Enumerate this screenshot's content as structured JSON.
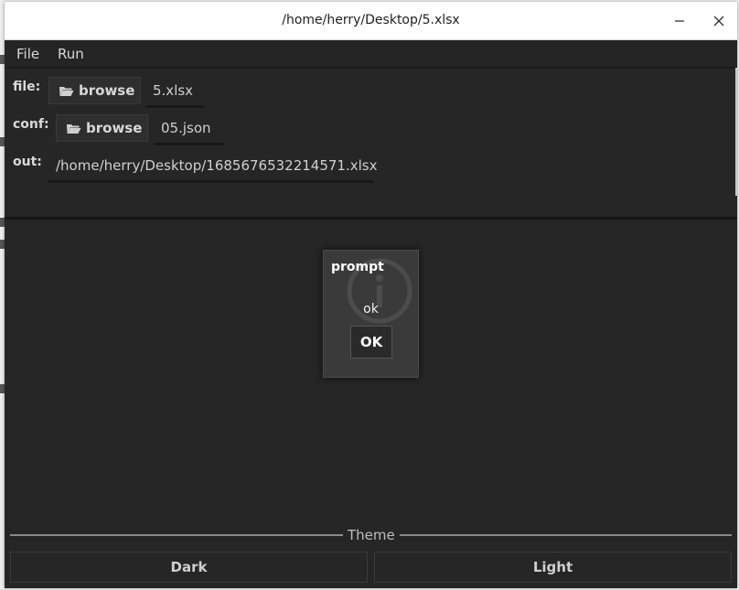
{
  "window": {
    "title": "/home/herry/Desktop/5.xlsx"
  },
  "menu": {
    "items": [
      "File",
      "Run"
    ]
  },
  "form": {
    "file_label": "file:",
    "file_browse": "browse",
    "file_value": "5.xlsx",
    "conf_label": "conf:",
    "conf_browse": "browse",
    "conf_value": "05.json",
    "out_label": "out:",
    "out_value": "/home/herry/Desktop/1685676532214571.xlsx"
  },
  "dialog": {
    "title": "prompt",
    "message": "ok",
    "ok_label": "OK",
    "icon": "info-icon"
  },
  "theme": {
    "label": "Theme",
    "dark_label": "Dark",
    "light_label": "Light"
  },
  "colors": {
    "background": "#262626",
    "text": "#d9d9d9",
    "dialog_bg": "#3a3a3a"
  }
}
